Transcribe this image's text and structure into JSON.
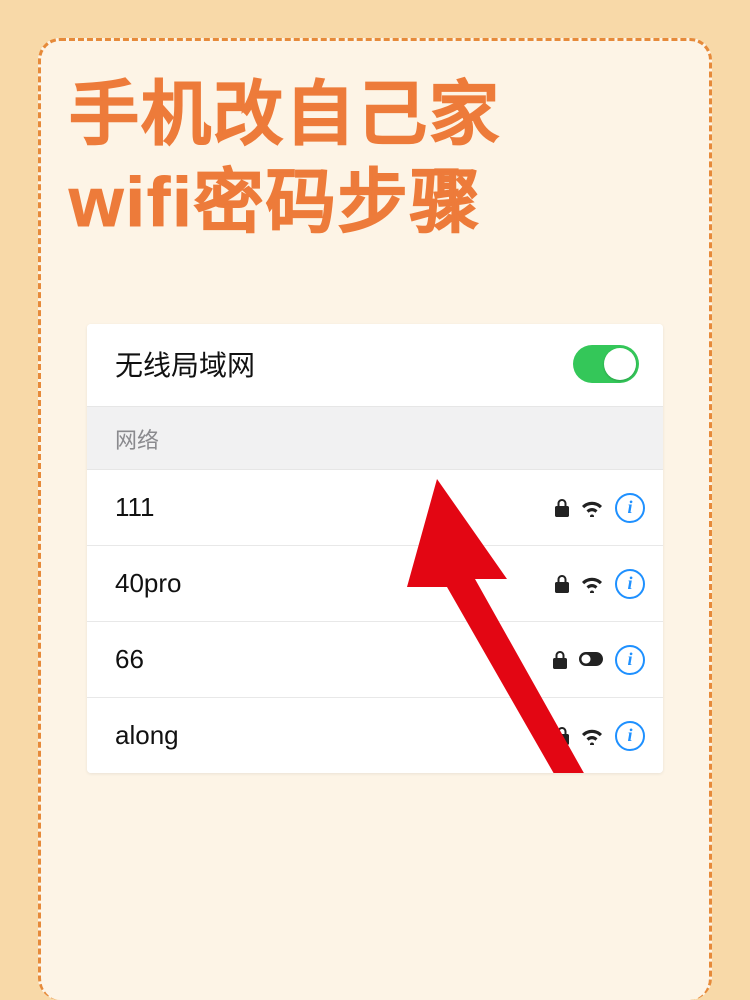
{
  "title_line1": "手机改自己家",
  "title_line2": "wifi密码步骤",
  "wlan": {
    "header_label": "无线局域网",
    "toggle_on": true,
    "section_label": "网络",
    "networks": [
      {
        "name": "111",
        "locked": true,
        "signal": "wifi"
      },
      {
        "name": "40pro",
        "locked": true,
        "signal": "wifi"
      },
      {
        "name": "66",
        "locked": true,
        "signal": "hotspot"
      },
      {
        "name": "along",
        "locked": true,
        "signal": "wifi"
      }
    ]
  },
  "info_glyph": "i"
}
